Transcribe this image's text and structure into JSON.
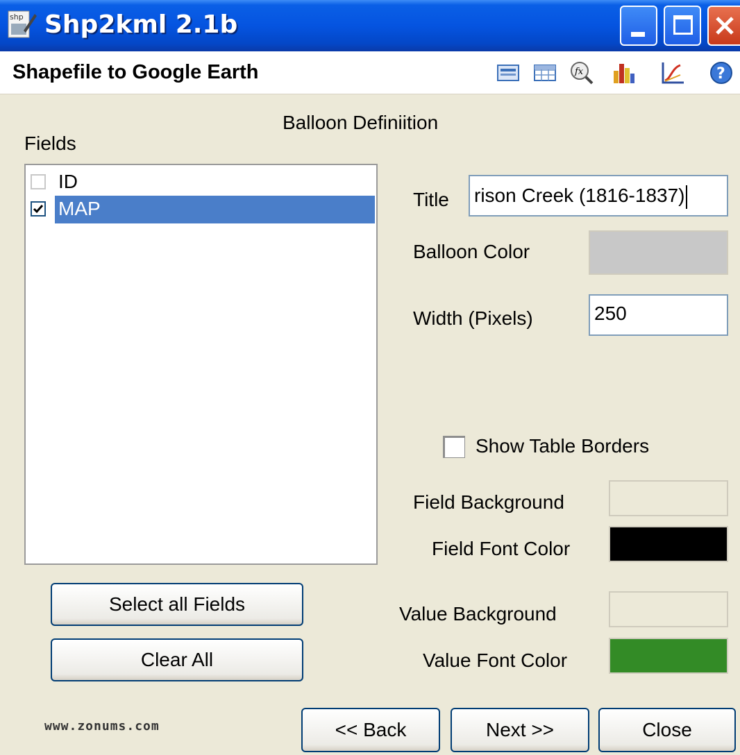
{
  "window": {
    "title": "Shp2kml 2.1b",
    "app_icon_text": "shp"
  },
  "header": {
    "subtitle": "Shapefile to Google Earth",
    "toolbar_icons": [
      "list-view-icon",
      "table-icon",
      "function-zoom-icon",
      "bar-chart-icon",
      "line-chart-icon",
      "help-icon"
    ]
  },
  "balloon": {
    "heading": "Balloon Definiition",
    "title_label": "Title",
    "title_value": "rison Creek (1816-1837)",
    "balloon_color_label": "Balloon Color",
    "balloon_color": "#c8c8c8",
    "width_label": "Width (Pixels)",
    "width_value": "250",
    "show_borders_label": "Show Table Borders",
    "show_borders_checked": false,
    "field_bg_label": "Field Background",
    "field_bg_color": "#ece9d8",
    "field_font_label": "Field Font Color",
    "field_font_color": "#000000",
    "value_bg_label": "Value Background",
    "value_bg_color": "#ece9d8",
    "value_font_label": "Value Font Color",
    "value_font_color": "#338b26"
  },
  "fields": {
    "label": "Fields",
    "items": [
      {
        "name": "ID",
        "checked": false,
        "selected": false
      },
      {
        "name": "MAP",
        "checked": true,
        "selected": true
      }
    ]
  },
  "buttons": {
    "select_all": "Select all Fields",
    "clear_all": "Clear All",
    "back": "<< Back",
    "next": "Next >>",
    "close": "Close"
  },
  "footer": {
    "website": "www.zonums.com"
  }
}
